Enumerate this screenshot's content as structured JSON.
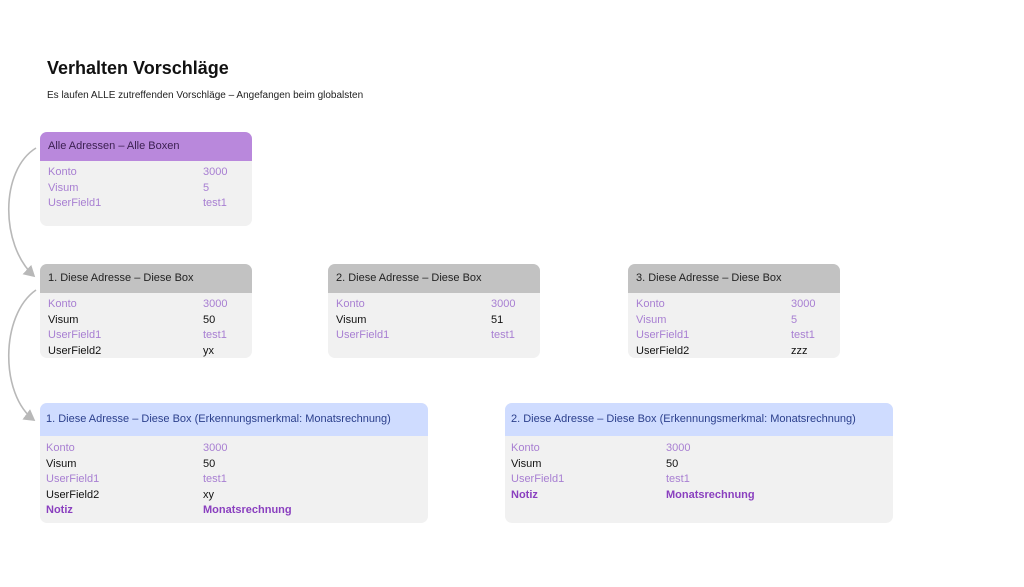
{
  "page": {
    "title": "Verhalten Vorschläge",
    "subtitle": "Es laufen ALLE zutreffenden Vorschläge – Angefangen beim globalsten"
  },
  "boxes": {
    "global": {
      "title": "Alle Adressen – Alle Boxen",
      "rows": [
        {
          "key": "Konto",
          "value": "3000"
        },
        {
          "key": "Visum",
          "value": "5"
        },
        {
          "key": "UserField1",
          "value": "test1"
        }
      ]
    },
    "box1": {
      "title": "1. Diese Adresse – Diese Box",
      "rows": [
        {
          "key": "Konto",
          "value": "3000"
        },
        {
          "key": "Visum",
          "value": "50"
        },
        {
          "key": "UserField1",
          "value": "test1"
        },
        {
          "key": "UserField2",
          "value": "yx"
        }
      ]
    },
    "box2": {
      "title": "2. Diese Adresse – Diese Box",
      "rows": [
        {
          "key": "Konto",
          "value": "3000"
        },
        {
          "key": "Visum",
          "value": "51"
        },
        {
          "key": "UserField1",
          "value": "test1"
        }
      ]
    },
    "box3": {
      "title": "3. Diese Adresse – Diese Box",
      "rows": [
        {
          "key": "Konto",
          "value": "3000"
        },
        {
          "key": "Visum",
          "value": "5"
        },
        {
          "key": "UserField1",
          "value": "test1"
        },
        {
          "key": "UserField2",
          "value": "zzz"
        }
      ]
    },
    "feature1": {
      "title": "1. Diese Adresse – Diese Box (Erkennungsmerkmal:  Monatsrechnung)",
      "rows": [
        {
          "key": "Konto",
          "value": "3000"
        },
        {
          "key": "Visum",
          "value": "50"
        },
        {
          "key": "UserField1",
          "value": "test1"
        },
        {
          "key": "UserField2",
          "value": "xy"
        },
        {
          "key": "Notiz",
          "value": "Monatsrechnung"
        }
      ]
    },
    "feature2": {
      "title": "2. Diese Adresse – Diese Box (Erkennungsmerkmal:  Monatsrechnung)",
      "rows": [
        {
          "key": "Konto",
          "value": "3000"
        },
        {
          "key": "Visum",
          "value": "50"
        },
        {
          "key": "UserField1",
          "value": "test1"
        },
        {
          "key": "Notiz",
          "value": "Monatsrechnung"
        }
      ]
    }
  },
  "colors": {
    "header_purple": "#b988dc",
    "header_gray": "#c2c2c2",
    "header_blue": "#cfdcff",
    "box_body": "#f1f1f1",
    "inherited_text": "#a87fd2",
    "note_text": "#8a3fbf",
    "arrow": "#b8b8b8"
  }
}
